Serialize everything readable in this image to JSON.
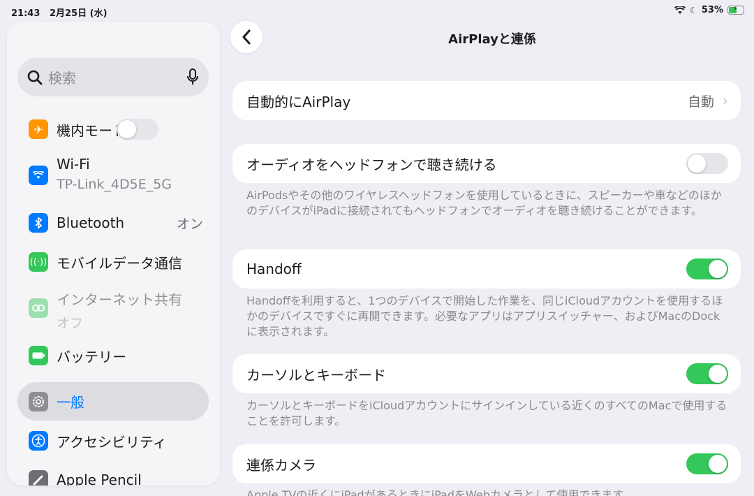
{
  "status_bar": {
    "time": "21:43",
    "date": "2月25日 (水)",
    "battery": "53%",
    "battery_level": 0.53
  },
  "sidebar": {
    "search_placeholder": "検索",
    "items": [
      {
        "label": "機内モード",
        "icon": "airplane-icon",
        "color": "#ff9500",
        "toggle": false
      },
      {
        "label": "Wi-Fi",
        "sub": "TP-Link_4D5E_5G",
        "icon": "wifi-icon",
        "color": "#007aff"
      },
      {
        "label": "Bluetooth",
        "value": "オン",
        "icon": "bluetooth-icon",
        "color": "#007aff"
      },
      {
        "label": "モバイルデータ通信",
        "icon": "antenna-icon",
        "color": "#34c759"
      },
      {
        "label": "インターネット共有",
        "sub": "オフ",
        "icon": "link-icon",
        "color": "#34c759"
      },
      {
        "label": "バッテリー",
        "icon": "battery-icon",
        "color": "#34c759"
      },
      {
        "label": "一般",
        "icon": "gear-icon",
        "color": "#8e8e93",
        "selected": true
      },
      {
        "label": "アクセシビリティ",
        "icon": "accessibility-icon",
        "color": "#007aff"
      },
      {
        "label": "Apple Pencil",
        "icon": "pencil-icon",
        "color": "#6d6d72"
      }
    ]
  },
  "main": {
    "title": "AirPlayと連係",
    "rows": [
      {
        "label": "自動的にAirPlay",
        "value": "自動"
      },
      {
        "label": "オーディオをヘッドフォンで聴き続ける",
        "toggle": false,
        "footnote": "AirPodsやその他のワイヤレスヘッドフォンを使用しているときに、スピーカーや車などのほかのデバイスがiPadに接続されてもヘッドフォンでオーディオを聴き続けることができます。"
      },
      {
        "label": "Handoff",
        "toggle": true,
        "footnote": "Handoffを利用すると、1つのデバイスで開始した作業を、同じiCloudアカウントを使用するほかのデバイスですぐに再開できます。必要なアプリはアプリスイッチャー、およびMacのDockに表示されます。"
      },
      {
        "label": "カーソルとキーボード",
        "toggle": true,
        "footnote": "カーソルとキーボードをiCloudアカウントにサインインしている近くのすべてのMacで使用することを許可します。"
      },
      {
        "label": "連係カメラ",
        "toggle": true,
        "footnote": "Apple TVの近くにiPadがあるときにiPadをWebカメラとして使用できます。"
      }
    ]
  },
  "colors": {
    "accent": "#007aff",
    "toggle_on": "#34c759"
  }
}
